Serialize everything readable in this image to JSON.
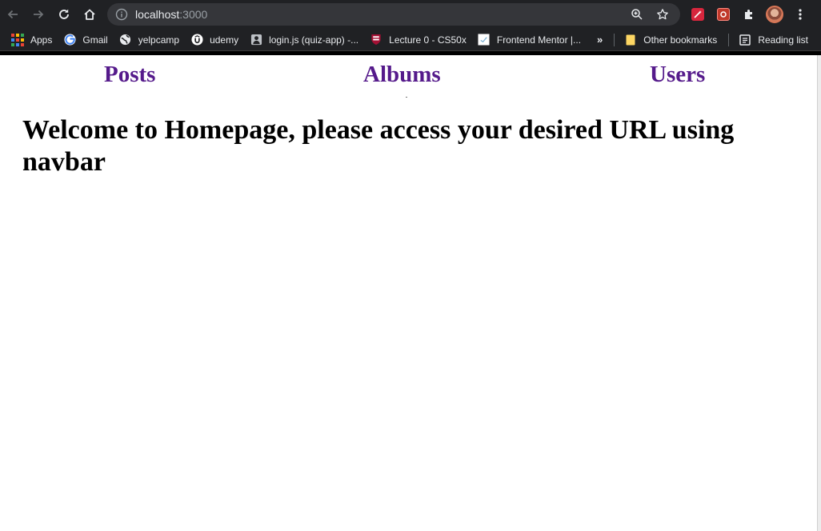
{
  "browser": {
    "url_host": "localhost",
    "url_port": ":3000",
    "bookmarks": [
      {
        "label": "Apps",
        "icon": "apps-grid-icon"
      },
      {
        "label": "Gmail",
        "icon": "google-icon"
      },
      {
        "label": "yelpcamp",
        "icon": "globe-icon"
      },
      {
        "label": "udemy",
        "icon": "udemy-icon"
      },
      {
        "label": "login.js (quiz-app) -...",
        "icon": "person-icon"
      },
      {
        "label": "Lecture 0 - CS50x",
        "icon": "harvard-shield-icon"
      },
      {
        "label": "Frontend Mentor |...",
        "icon": "frontend-mentor-icon"
      }
    ],
    "overflow_chevron": "»",
    "other_bookmarks": "Other bookmarks",
    "reading_list": "Reading list"
  },
  "page": {
    "nav": {
      "posts": "Posts",
      "albums": "Albums",
      "users": "Users"
    },
    "heading": "Welcome to Homepage, please access your desired URL using navbar",
    "link_color": "#551a8b"
  }
}
